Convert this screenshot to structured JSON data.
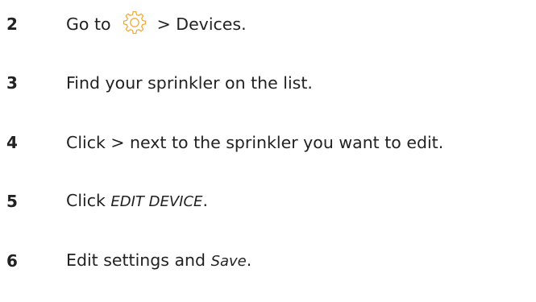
{
  "steps": [
    {
      "number": "2",
      "pre": "Go to",
      "icon": "gear-icon",
      "post": "> Devices."
    },
    {
      "number": "3",
      "text": "Find your sprinkler on the list."
    },
    {
      "number": "4",
      "text": "Click > next to the sprinkler you want to edit."
    },
    {
      "number": "5",
      "pre": "Click ",
      "em": "EDIT DEVICE",
      "post": "."
    },
    {
      "number": "6",
      "pre": "Edit settings and ",
      "em": "Save",
      "post": "."
    }
  ],
  "colors": {
    "text": "#222222",
    "icon": "#f2a93b"
  }
}
